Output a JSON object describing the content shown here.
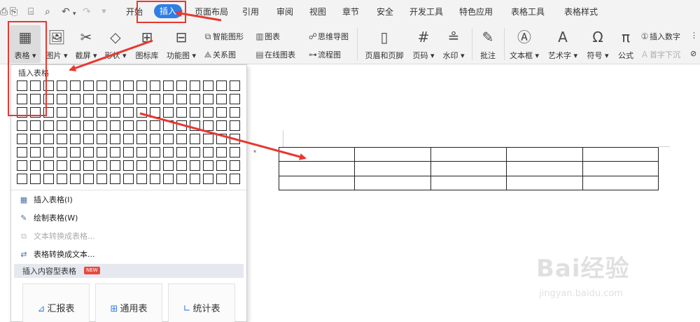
{
  "quick_access": {
    "icons": [
      "save-icon",
      "print-icon",
      "print-preview-icon",
      "undo-icon",
      "redo-icon"
    ]
  },
  "menu": {
    "tabs": [
      {
        "id": "start",
        "label": "开始"
      },
      {
        "id": "insert",
        "label": "插入",
        "active": true
      },
      {
        "id": "page_layout",
        "label": "页面布局"
      },
      {
        "id": "reference",
        "label": "引用"
      },
      {
        "id": "review",
        "label": "审阅"
      },
      {
        "id": "view",
        "label": "视图"
      },
      {
        "id": "chapter",
        "label": "章节"
      },
      {
        "id": "security",
        "label": "安全"
      },
      {
        "id": "dev_tools",
        "label": "开发工具"
      },
      {
        "id": "features",
        "label": "特色应用"
      },
      {
        "id": "table_tools",
        "label": "表格工具"
      },
      {
        "id": "table_style",
        "label": "表格样式"
      }
    ]
  },
  "ribbon": {
    "table": "表格",
    "picture": "图片",
    "screenshot": "截屏",
    "shape": "形状",
    "icon_lib": "图标库",
    "func_chart": "功能图",
    "smart_shape": "智能图形",
    "chart": "图表",
    "mind_map": "思维导图",
    "relation": "关系图",
    "online_chart": "在线图表",
    "flowchart": "流程图",
    "header_footer": "页眉和页脚",
    "page_num": "页码",
    "watermark": "水印",
    "comment": "批注",
    "text_box": "文本框",
    "art_text": "艺术字",
    "symbol": "符号",
    "formula": "公式",
    "insert_number": "插入数字",
    "drop_cap": "首字下沉"
  },
  "dropdown": {
    "title": "插入表格",
    "grid": {
      "rows": 8,
      "cols": 17
    },
    "items": [
      {
        "label": "插入表格(I)",
        "icon": "table-grid-icon",
        "disabled": false
      },
      {
        "label": "绘制表格(W)",
        "icon": "draw-table-icon",
        "disabled": false
      },
      {
        "label": "文本转换成表格...",
        "icon": "text-to-table-icon",
        "disabled": true
      },
      {
        "label": "表格转换成文本...",
        "icon": "table-to-text-icon",
        "disabled": false
      }
    ],
    "content_section": {
      "title": "插入内容型表格",
      "badge": "NEW"
    },
    "cards": [
      {
        "label": "汇报表",
        "icon": "report-icon"
      },
      {
        "label": "通用表",
        "icon": "generic-table-icon"
      },
      {
        "label": "统计表",
        "icon": "stats-chart-icon"
      }
    ]
  },
  "document": {
    "table": {
      "rows": 3,
      "cols": 5
    }
  },
  "watermark": {
    "text": "Bai经验",
    "sub": "jingyan.baidu.com"
  },
  "colors": {
    "accent": "#2f7ee6",
    "annotation": "#e8382f",
    "new_badge": "#e8493f"
  }
}
